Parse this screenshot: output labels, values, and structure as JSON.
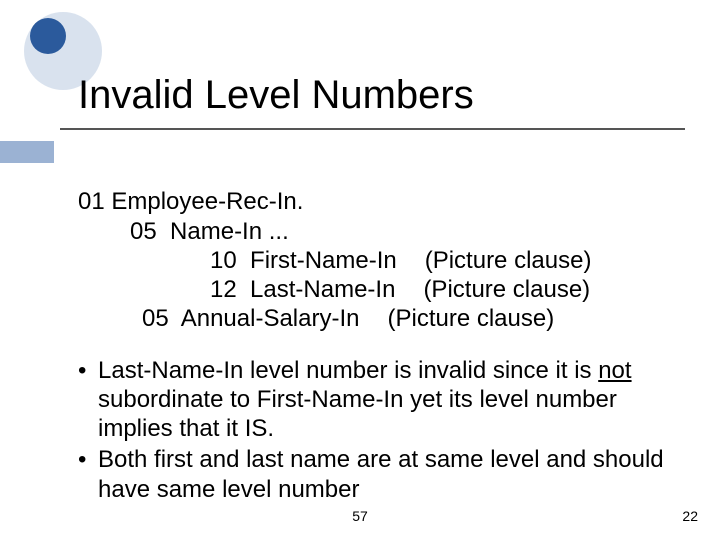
{
  "title": "Invalid Level Numbers",
  "code": {
    "l1": "01 Employee-Rec-In.",
    "l2_lvl": "05",
    "l2_name": "Name-In ...",
    "l3_lvl": "10",
    "l3_name": "First-Name-In",
    "l3_pic": "(Picture clause)",
    "l4_lvl": "12",
    "l4_name": "Last-Name-In",
    "l4_pic": "(Picture clause)",
    "l5_lvl": "05",
    "l5_name": "Annual-Salary-In",
    "l5_pic": "(Picture clause)"
  },
  "bullets": {
    "b1_a": "Last-Name-In level number is invalid since it is ",
    "b1_not": "not",
    "b1_b": " subordinate to First-Name-In yet its level number implies that it IS.",
    "b2": "Both first and last name are at same level and should have same level number"
  },
  "footer": {
    "center": "57",
    "right": "22"
  }
}
